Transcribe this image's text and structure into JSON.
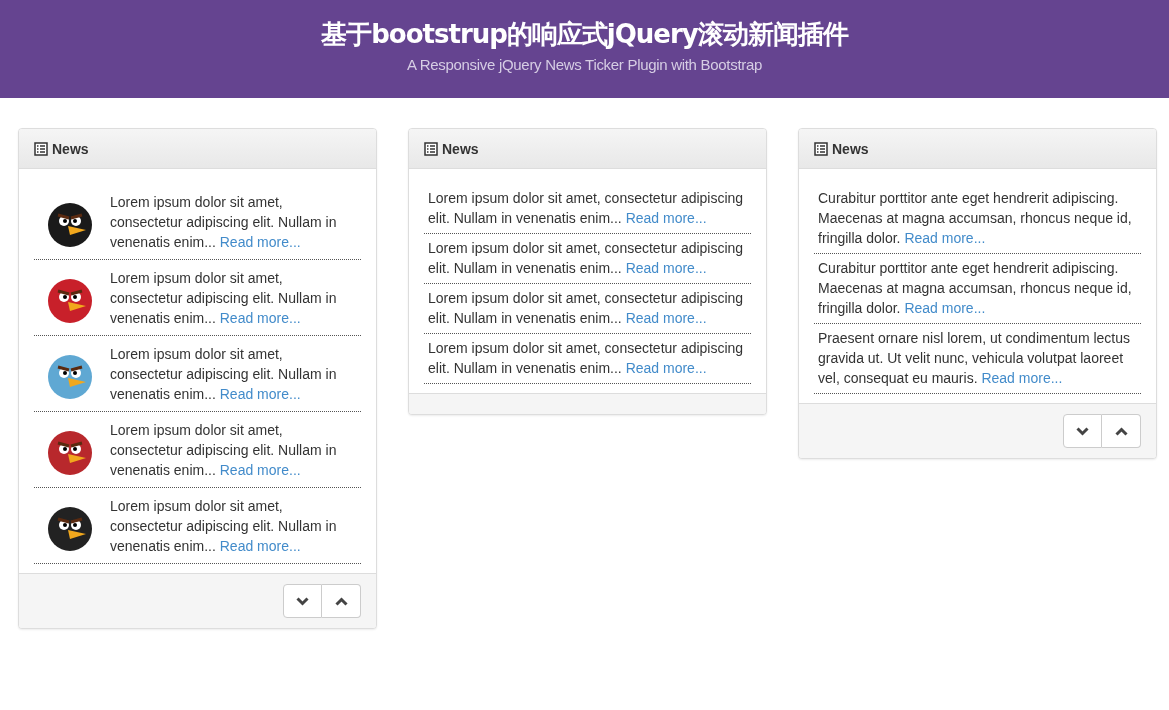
{
  "header": {
    "title": "基于bootstrup的响应式jQuery滚动新闻插件",
    "subtitle": "A Responsive jQuery News Ticker Plugin with Bootstrap"
  },
  "panels": [
    {
      "title": "News",
      "show_controls": true,
      "items": [
        {
          "color": "#1a1a1a",
          "text": "Lorem ipsum dolor sit amet, consectetur adipiscing elit. Nullam in venenatis enim... ",
          "link": "Read more..."
        },
        {
          "color": "#c8202a",
          "text": "Lorem ipsum dolor sit amet, consectetur adipiscing elit. Nullam in venenatis enim... ",
          "link": "Read more..."
        },
        {
          "color": "#5fa8d3",
          "text": "Lorem ipsum dolor sit amet, consectetur adipiscing elit. Nullam in venenatis enim... ",
          "link": "Read more..."
        },
        {
          "color": "#b8282c",
          "text": "Lorem ipsum dolor sit amet, consectetur adipiscing elit. Nullam in venenatis enim... ",
          "link": "Read more..."
        },
        {
          "color": "#222222",
          "text": "Lorem ipsum dolor sit amet, consectetur adipiscing elit. Nullam in venenatis enim... ",
          "link": "Read more..."
        }
      ]
    },
    {
      "title": "News",
      "show_controls": false,
      "items": [
        {
          "text": "Lorem ipsum dolor sit amet, consectetur adipiscing elit. Nullam in venenatis enim... ",
          "link": "Read more..."
        },
        {
          "text": "Lorem ipsum dolor sit amet, consectetur adipiscing elit. Nullam in venenatis enim... ",
          "link": "Read more..."
        },
        {
          "text": "Lorem ipsum dolor sit amet, consectetur adipiscing elit. Nullam in venenatis enim... ",
          "link": "Read more..."
        },
        {
          "text": "Lorem ipsum dolor sit amet, consectetur adipiscing elit. Nullam in venenatis enim... ",
          "link": "Read more..."
        }
      ]
    },
    {
      "title": "News",
      "show_controls": true,
      "items": [
        {
          "text": "Curabitur porttitor ante eget hendrerit adipiscing. Maecenas at magna accumsan, rhoncus neque id, fringilla dolor. ",
          "link": "Read more..."
        },
        {
          "text": "Curabitur porttitor ante eget hendrerit adipiscing. Maecenas at magna accumsan, rhoncus neque id, fringilla dolor. ",
          "link": "Read more..."
        },
        {
          "text": "Praesent ornare nisl lorem, ut condimentum lectus gravida ut. Ut velit nunc, vehicula volutpat laoreet vel, consequat eu mauris. ",
          "link": "Read more..."
        }
      ]
    }
  ]
}
